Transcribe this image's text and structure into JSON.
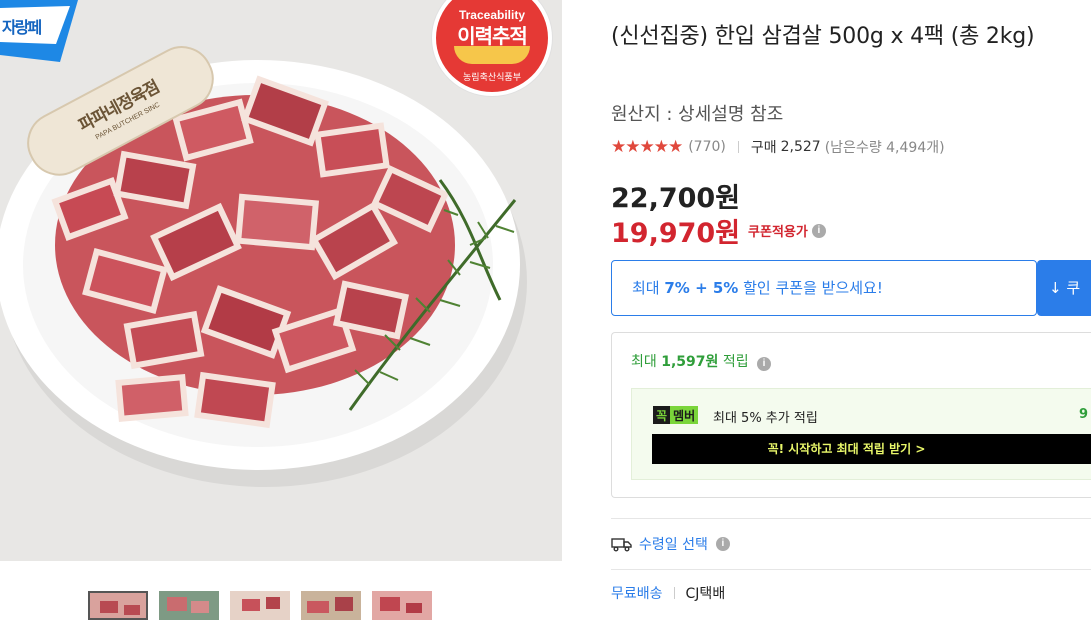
{
  "image": {
    "badge_corner_text": "자랑페",
    "trace_badge": {
      "english": "Traceability",
      "korean": "이력추적",
      "organization": "농림축산식품부"
    },
    "brand_tag_text": "파파네정육점",
    "brand_tag_sub": "PAPA BUTCHER SINC"
  },
  "thumbnails": [
    "thumb-1",
    "thumb-2",
    "thumb-3",
    "thumb-4",
    "thumb-5"
  ],
  "product": {
    "title": "(신선집중) 한입 삼겹살 500g x 4팩 (총 2kg)",
    "origin": "원산지 : 상세설명 참조"
  },
  "rating": {
    "stars": "★★★★★",
    "review_count": "(770)",
    "purchase_label": "구매",
    "purchase_count": "2,527",
    "stock": "(남은수량 4,494개)"
  },
  "price": {
    "original": "22,700원",
    "sale": "19,970원",
    "coupon_applied": "쿠폰적용가"
  },
  "coupon": {
    "prefix": "최대 ",
    "highlight": "7% + 5%",
    "suffix": " 할인 쿠폰을 받으세요!",
    "download_label": "↓ 쿠"
  },
  "points": {
    "prefix": "최대 ",
    "amount": "1,597원",
    "suffix": " 적립",
    "member_logo_1": "꼭",
    "member_logo_2": "멤버",
    "member_text": "최대 5% 추가 적립",
    "member_right": "9",
    "member_cta": "꼭! 시작하고 최대 적립 받기 >"
  },
  "delivery": {
    "date_select": "수령일 선택",
    "free_shipping": "무료배송",
    "carrier": "CJ택배"
  },
  "colors": {
    "accent_blue": "#2b7de9",
    "sale_red": "#d2252f",
    "points_green": "#2f9e3a",
    "star_red": "#e0483c"
  }
}
